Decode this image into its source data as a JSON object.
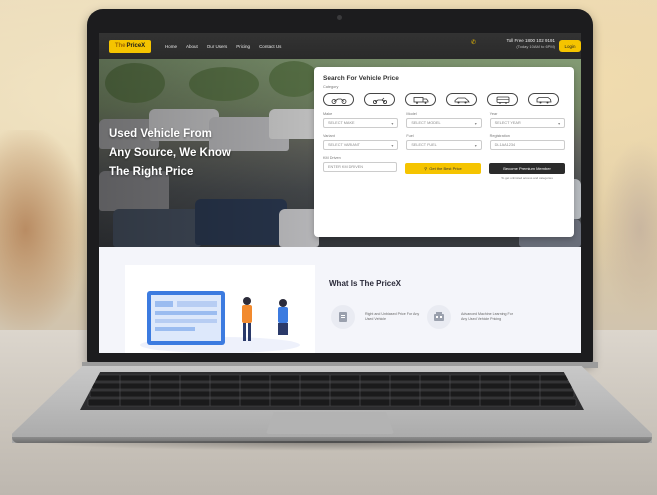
{
  "site": {
    "logo_prefix": "The",
    "logo_name": "PriceX",
    "nav_items": [
      "Home",
      "About",
      "Our Users",
      "Pricing",
      "Contact Us"
    ],
    "tollfree": "Toll Free 1800 102 9191",
    "tollfree_sub": "(Today 10AM to 6PM)",
    "login": "Login"
  },
  "hero": {
    "title_line1": "Used Vehicle From",
    "title_line2": "Any Source, We Know",
    "title_line3": "The Right Price"
  },
  "search_card": {
    "title": "Search For Vehicle Price",
    "category_label": "Category",
    "vehicle_types": [
      "motorcycle-icon",
      "scooter-icon",
      "truck-icon",
      "car-icon",
      "bus-icon",
      "suv-icon"
    ],
    "make_label": "Make",
    "make_value": "SELECT MAKE",
    "model_label": "Model",
    "model_value": "SELECT MODEL",
    "year_label": "Year",
    "year_value": "SELECT YEAR",
    "variant_label": "Variant",
    "variant_value": "SELECT VARIANT",
    "fuel_label": "Fuel",
    "fuel_value": "SELECT FUEL",
    "registration_label": "Registration",
    "registration_value": "DL1AA1234",
    "km_label": "KM Driven",
    "km_value": "ENTER KM DRIVEN",
    "best_price_button": "Get the Best Price",
    "premium_button": "Become Premium Member",
    "premium_note": "To get unlimited access and categories"
  },
  "about": {
    "title": "What Is The PriceX",
    "feature1": "Right and Unbiased Price For Any Used Vehicle",
    "feature2": "Advanced Machine Learning For Any Used Vehicle Pricing"
  },
  "colors": {
    "brand_yellow": "#f5c400",
    "nav_dark": "#2a2a2a",
    "button_dark": "#2b2b2b"
  }
}
